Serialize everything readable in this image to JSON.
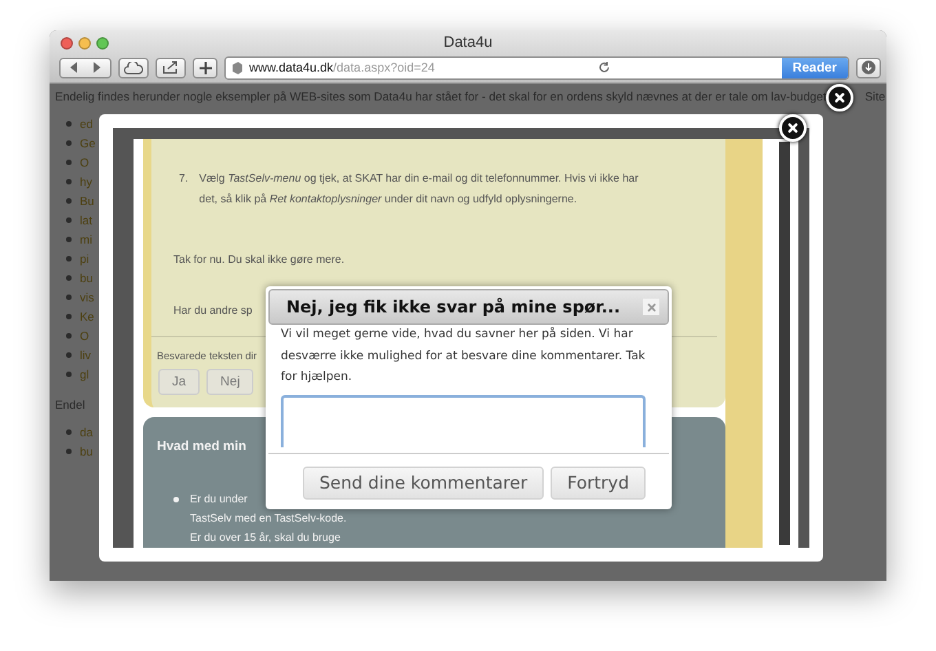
{
  "window": {
    "title": "Data4u"
  },
  "toolbar": {
    "url_host": "www.data4u.dk",
    "url_path": "/data.aspx?oid=24",
    "reader_button": "Reader"
  },
  "page": {
    "intro": "Endelig findes herunder nogle eksempler på WEB-sites som Data4u har stået for - det skal for en ordens skyld nævnes at der er tale om lav-budget",
    "intro_end": "Site",
    "links": [
      "ed",
      "Ge",
      "O",
      "hy",
      "Bu",
      "lat",
      "mi",
      "pi",
      "bu",
      "vis",
      "Ke",
      "O",
      "liv",
      "gl"
    ],
    "outro": "Endel",
    "links_2": [
      "da",
      "bu"
    ]
  },
  "lightbox": {
    "content": {
      "step_number": "7.",
      "step": "Vælg *TastSelv-menu* og tjek, at SKAT har din e-mail og dit telefonnummer. Hvis vi ikke har det, så klik på *Ret kontaktoplysninger* under dit navn og udfyld oplysningerne.",
      "thanks": "Tak for nu. Du skal ikke gøre mere.",
      "more": "Har du andre sp",
      "feedback_label": "Besvarede teksten dir",
      "buttons": [
        "Ja",
        "Nej"
      ]
    },
    "info": {
      "heading": "Hvad med min",
      "items": [
        {
          "lines": [
            "Er du under",
            "TastSelv med en TastSelv-kode.",
            "Er du over 15 år, skal du bruge"
          ]
        }
      ]
    }
  },
  "dialog": {
    "title": "Nej, jeg fik ikke svar på mine spør...",
    "message": "Vi vil meget gerne vide, hvad du savner her på siden. Vi har desværre ikke mulighed for at besvare dine kommentarer. Tak for hjælpen.",
    "buttons": [
      {
        "label": "Send dine kommentarer"
      },
      {
        "label": "Fortryd"
      }
    ]
  }
}
